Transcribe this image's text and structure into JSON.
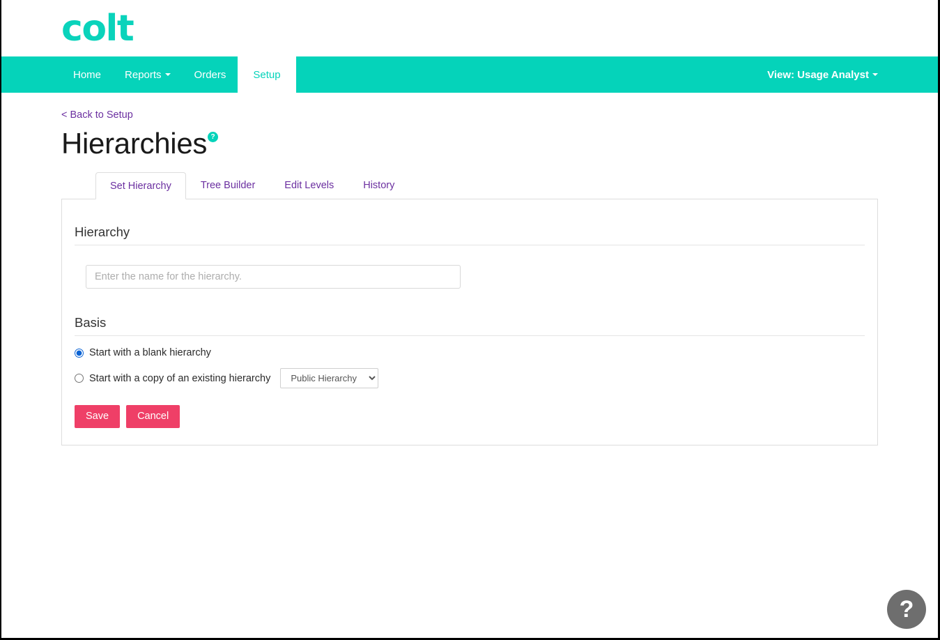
{
  "brand": {
    "logo_text": "colt",
    "teal": "#05d3ba",
    "pink": "#ef3f67",
    "purple": "#6b2fa0"
  },
  "navbar": {
    "items": [
      {
        "label": "Home",
        "caret": false,
        "active": false
      },
      {
        "label": "Reports",
        "caret": true,
        "active": false
      },
      {
        "label": "Orders",
        "caret": false,
        "active": false
      },
      {
        "label": "Setup",
        "caret": false,
        "active": true
      }
    ],
    "view_selector": "View: Usage Analyst"
  },
  "breadcrumb": {
    "back_label": "< Back to Setup"
  },
  "page": {
    "title": "Hierarchies",
    "help_badge": "?"
  },
  "tabs": [
    {
      "label": "Set Hierarchy",
      "active": true
    },
    {
      "label": "Tree Builder",
      "active": false
    },
    {
      "label": "Edit Levels",
      "active": false
    },
    {
      "label": "History",
      "active": false
    }
  ],
  "form": {
    "hierarchy_heading": "Hierarchy",
    "hierarchy_name": {
      "value": "",
      "placeholder": "Enter the name for the hierarchy."
    },
    "basis_heading": "Basis",
    "options": [
      {
        "label": "Start with a blank hierarchy",
        "selected": true
      },
      {
        "label": "Start with a copy of an existing hierarchy",
        "selected": false
      }
    ],
    "existing_hierarchy_select": {
      "selected": "Public Hierarchy",
      "options": [
        "Public Hierarchy"
      ]
    },
    "save_label": "Save",
    "cancel_label": "Cancel"
  },
  "help_fab": {
    "glyph": "?"
  }
}
